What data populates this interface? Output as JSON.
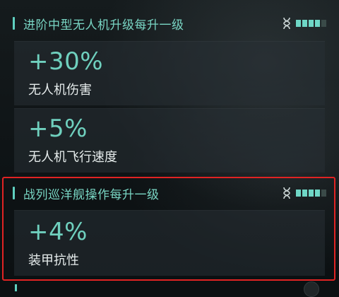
{
  "sections": [
    {
      "title": "进阶中型无人机升级每升一级",
      "level_filled": 4,
      "level_total": 5,
      "stats": [
        {
          "value": "+30%",
          "label": "无人机伤害"
        },
        {
          "value": "+5%",
          "label": "无人机飞行速度"
        }
      ]
    },
    {
      "title": "战列巡洋舰操作每升一级",
      "level_filled": 4,
      "level_total": 5,
      "stats": [
        {
          "value": "+4%",
          "label": "装甲抗性"
        }
      ]
    }
  ],
  "icons": {
    "level": "dna-helix-icon"
  },
  "colors": {
    "accent": "#6fd0be",
    "highlight": "#e02323",
    "pip_off": "#3a4a48"
  }
}
